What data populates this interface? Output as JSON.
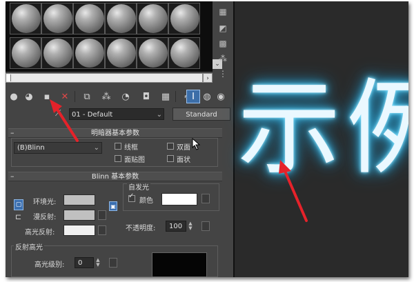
{
  "material_editor": {
    "material_name": "01 - Default",
    "type_button": "Standard",
    "shader_rollout": {
      "title": "明暗器基本参数",
      "shader_type": "(B)Blinn",
      "options": [
        "线框",
        "双面",
        "面贴图",
        "面状"
      ]
    },
    "blinn_rollout": {
      "title": "Blinn 基本参数",
      "self_illum_group": "自发光",
      "color_check_label": "颜色",
      "ambient_label": "环境光:",
      "diffuse_label": "漫反射:",
      "specular_label": "高光反射:",
      "opacity_label": "不透明度:",
      "opacity_value": "100"
    },
    "specular_highlights": {
      "group_title": "反射高光",
      "specular_level_label": "高光级别:",
      "specular_level_value": "0"
    },
    "toolbar_icons": [
      "get-material-icon",
      "put-to-scene-icon",
      "assign-material-icon",
      "delete-icon",
      "copy-material-icon",
      "unique-icon",
      "material-id-icon",
      "show-map-icon",
      "show-end-result-icon",
      "go-to-parent-icon",
      "go-forward-icon",
      "background-icon",
      "options-icon"
    ],
    "colors": {
      "self_illum_swatch": "#ffffff",
      "ambient_swatch": "#c0c0c0",
      "diffuse_swatch": "#c0c0c0",
      "specular_swatch": "#f0f0f0",
      "accent": "#3c6ea8",
      "annotation_arrow": "#e5222a"
    }
  },
  "viewport": {
    "text": "示例",
    "glow_color": "#4fc8f2"
  }
}
